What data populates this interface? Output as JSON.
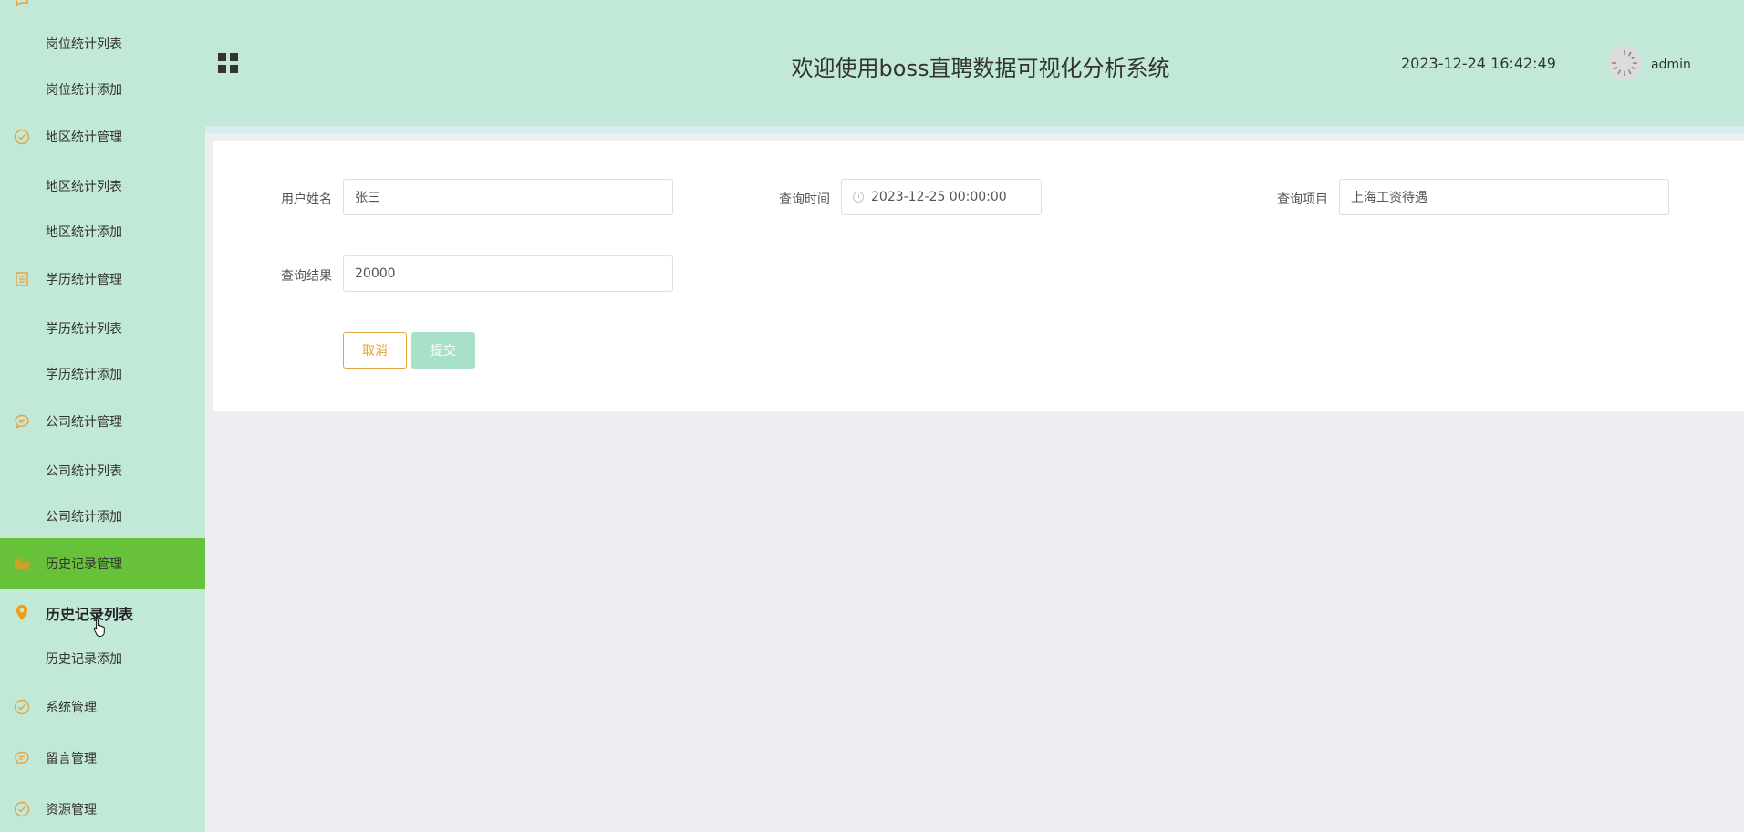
{
  "header": {
    "title": "欢迎使用boss直聘数据可视化分析系统",
    "datetime": "2023-12-24 16:42:49",
    "username": "admin"
  },
  "sidebar": {
    "items": [
      {
        "label": "岗位统计列表",
        "type": "sub"
      },
      {
        "label": "岗位统计添加",
        "type": "sub"
      },
      {
        "label": "地区统计管理",
        "type": "group",
        "icon": "check-circle-icon"
      },
      {
        "label": "地区统计列表",
        "type": "sub"
      },
      {
        "label": "地区统计添加",
        "type": "sub"
      },
      {
        "label": "学历统计管理",
        "type": "group",
        "icon": "document-icon"
      },
      {
        "label": "学历统计列表",
        "type": "sub"
      },
      {
        "label": "学历统计添加",
        "type": "sub"
      },
      {
        "label": "公司统计管理",
        "type": "group",
        "icon": "chat-icon"
      },
      {
        "label": "公司统计列表",
        "type": "sub"
      },
      {
        "label": "公司统计添加",
        "type": "sub"
      },
      {
        "label": "历史记录管理",
        "type": "group",
        "icon": "folder-icon"
      },
      {
        "label": "历史记录列表",
        "type": "sub",
        "icon": "location-pin-icon"
      },
      {
        "label": "历史记录添加",
        "type": "sub"
      },
      {
        "label": "系统管理",
        "type": "group",
        "icon": "check-circle-icon"
      },
      {
        "label": "留言管理",
        "type": "group",
        "icon": "chat-icon"
      },
      {
        "label": "资源管理",
        "type": "group",
        "icon": "check-circle-icon"
      }
    ]
  },
  "form": {
    "username_label": "用户姓名",
    "username_value": "张三",
    "time_label": "查询时间",
    "time_value": "2023-12-25 00:00:00",
    "item_label": "查询项目",
    "item_value": "上海工资待遇",
    "result_label": "查询结果",
    "result_value": "20000",
    "cancel_label": "取消",
    "submit_label": "提交"
  },
  "colors": {
    "sidebar_bg": "#c2e9d8",
    "active_bg": "#67c23a",
    "icon_accent": "#e6a23c",
    "submit_bg": "#a8e0c8"
  }
}
